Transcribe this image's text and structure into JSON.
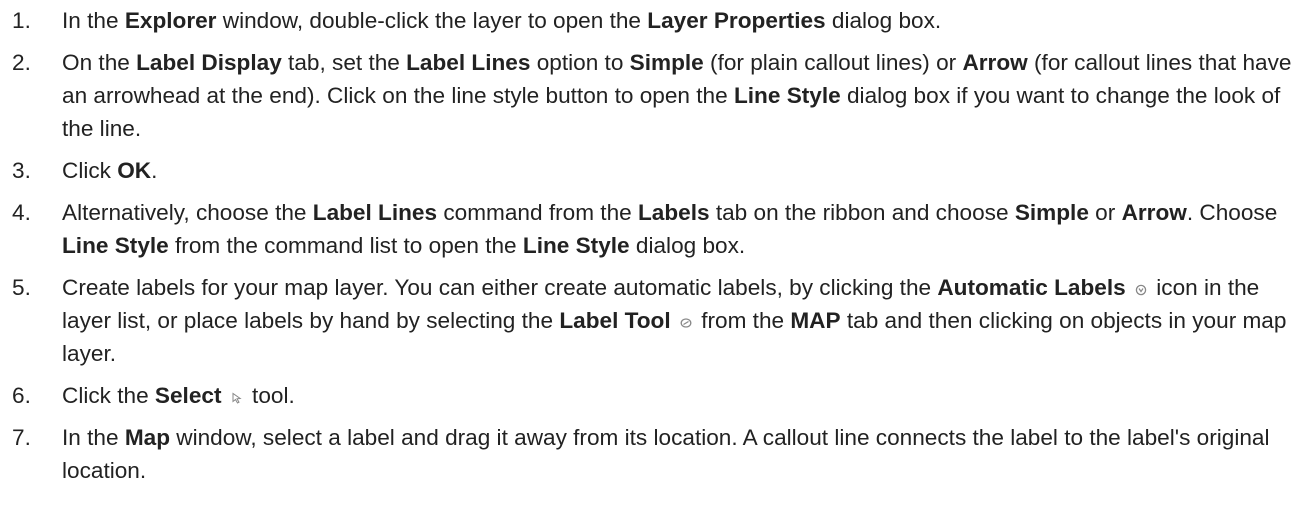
{
  "steps": [
    {
      "number": "1.",
      "parts": [
        {
          "text": "In the "
        },
        {
          "text": "Explorer",
          "bold": true
        },
        {
          "text": " window, double-click the layer to open the "
        },
        {
          "text": "Layer Properties",
          "bold": true
        },
        {
          "text": " dialog box."
        }
      ]
    },
    {
      "number": "2.",
      "parts": [
        {
          "text": "On the "
        },
        {
          "text": "Label Display",
          "bold": true
        },
        {
          "text": " tab, set the "
        },
        {
          "text": "Label Lines",
          "bold": true
        },
        {
          "text": " option to "
        },
        {
          "text": "Simple",
          "bold": true
        },
        {
          "text": " (for plain callout lines) or "
        },
        {
          "text": "Arrow",
          "bold": true
        },
        {
          "text": " (for callout lines that have an arrowhead at the end). Click on the line style button to open the "
        },
        {
          "text": "Line Style",
          "bold": true
        },
        {
          "text": " dialog box if you want to change the look of the line."
        }
      ]
    },
    {
      "number": "3.",
      "parts": [
        {
          "text": "Click "
        },
        {
          "text": "OK",
          "bold": true
        },
        {
          "text": "."
        }
      ]
    },
    {
      "number": "4.",
      "parts": [
        {
          "text": "Alternatively, choose the "
        },
        {
          "text": "Label Lines",
          "bold": true
        },
        {
          "text": " command from the "
        },
        {
          "text": "Labels",
          "bold": true
        },
        {
          "text": " tab on the ribbon and choose "
        },
        {
          "text": "Simple",
          "bold": true
        },
        {
          "text": " or "
        },
        {
          "text": "Arrow",
          "bold": true
        },
        {
          "text": ". Choose "
        },
        {
          "text": "Line Style",
          "bold": true
        },
        {
          "text": " from the command list to open the "
        },
        {
          "text": "Line Style",
          "bold": true
        },
        {
          "text": " dialog box."
        }
      ]
    },
    {
      "number": "5.",
      "parts": [
        {
          "text": "Create labels for your map layer. You can either create automatic labels, by clicking the "
        },
        {
          "text": "Automatic Labels",
          "bold": true
        },
        {
          "text": " "
        },
        {
          "icon": "automatic-labels-icon"
        },
        {
          "text": " icon in the layer list, or place labels by hand by selecting the "
        },
        {
          "text": "Label Tool",
          "bold": true
        },
        {
          "text": " "
        },
        {
          "icon": "label-tool-icon"
        },
        {
          "text": " from the "
        },
        {
          "text": "MAP",
          "bold": true
        },
        {
          "text": " tab and then clicking on objects in your map layer."
        }
      ]
    },
    {
      "number": "6.",
      "parts": [
        {
          "text": "Click the "
        },
        {
          "text": "Select",
          "bold": true
        },
        {
          "text": " "
        },
        {
          "icon": "select-pointer-icon"
        },
        {
          "text": " tool."
        }
      ]
    },
    {
      "number": "7.",
      "parts": [
        {
          "text": "In the "
        },
        {
          "text": "Map",
          "bold": true
        },
        {
          "text": " window, select a label and drag it away from its location. A callout line connects the label to the label's original location."
        }
      ]
    }
  ],
  "colors": {
    "text": "#222222",
    "icon": "#888888"
  }
}
